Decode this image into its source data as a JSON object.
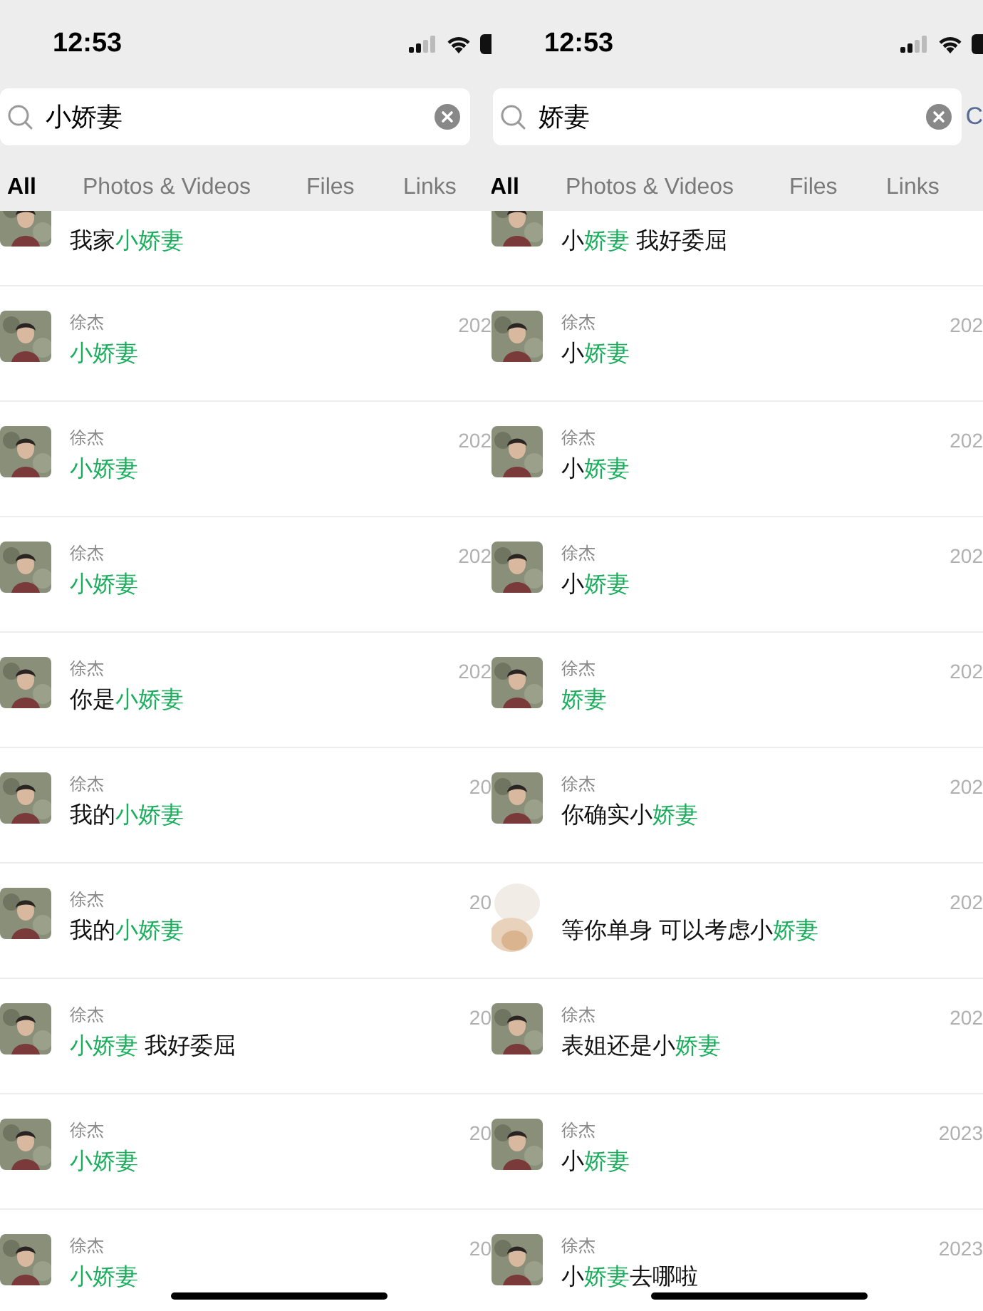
{
  "screens": [
    {
      "status_bar": {
        "time": "12:53"
      },
      "search": {
        "value": "小娇妻"
      },
      "tabs": [
        {
          "label": "All",
          "selected": true
        },
        {
          "label": "Photos & Videos",
          "selected": false
        },
        {
          "label": "Files",
          "selected": false
        },
        {
          "label": "Links",
          "selected": false
        }
      ],
      "results": [
        {
          "obscured": false,
          "message": [
            {
              "text": "我家",
              "highlight": false
            },
            {
              "text": "小娇妻",
              "highlight": true
            }
          ]
        },
        {
          "obscured": false,
          "name": "徐杰",
          "date": "202",
          "message": [
            {
              "text": "小娇妻",
              "highlight": true
            }
          ]
        },
        {
          "obscured": false,
          "name": "徐杰",
          "date": "202",
          "message": [
            {
              "text": "小娇妻",
              "highlight": true
            }
          ]
        },
        {
          "obscured": false,
          "name": "徐杰",
          "date": "202",
          "message": [
            {
              "text": "小娇妻",
              "highlight": true
            }
          ]
        },
        {
          "obscured": false,
          "name": "徐杰",
          "date": "202",
          "message": [
            {
              "text": "你是",
              "highlight": false
            },
            {
              "text": "小娇妻",
              "highlight": true
            }
          ]
        },
        {
          "obscured": false,
          "name": "徐杰",
          "date": "20",
          "message": [
            {
              "text": "我的",
              "highlight": false
            },
            {
              "text": "小娇妻",
              "highlight": true
            }
          ]
        },
        {
          "obscured": false,
          "name": "徐杰",
          "date": "20",
          "message": [
            {
              "text": "我的",
              "highlight": false
            },
            {
              "text": "小娇妻",
              "highlight": true
            }
          ]
        },
        {
          "obscured": false,
          "name": "徐杰",
          "date": "20",
          "message": [
            {
              "text": "小娇妻",
              "highlight": true
            },
            {
              "text": " 我好委屈",
              "highlight": false
            }
          ]
        },
        {
          "obscured": false,
          "name": "徐杰",
          "date": "20",
          "message": [
            {
              "text": "小娇妻",
              "highlight": true
            }
          ]
        },
        {
          "obscured": false,
          "name": "徐杰",
          "date": "20",
          "message": [
            {
              "text": "小娇妻",
              "highlight": true
            }
          ]
        }
      ]
    },
    {
      "status_bar": {
        "time": "12:53"
      },
      "search": {
        "value": "娇妻"
      },
      "cancel": "C",
      "tabs": [
        {
          "label": "All",
          "selected": true
        },
        {
          "label": "Photos & Videos",
          "selected": false
        },
        {
          "label": "Files",
          "selected": false
        },
        {
          "label": "Links",
          "selected": false
        }
      ],
      "results": [
        {
          "obscured": false,
          "message": [
            {
              "text": "小",
              "highlight": false
            },
            {
              "text": "娇妻",
              "highlight": true
            },
            {
              "text": " 我好委屈",
              "highlight": false
            }
          ]
        },
        {
          "obscured": false,
          "name": "徐杰",
          "date": "202",
          "message": [
            {
              "text": "小",
              "highlight": false
            },
            {
              "text": "娇妻",
              "highlight": true
            }
          ]
        },
        {
          "obscured": false,
          "name": "徐杰",
          "date": "202",
          "message": [
            {
              "text": "小",
              "highlight": false
            },
            {
              "text": "娇妻",
              "highlight": true
            }
          ]
        },
        {
          "obscured": false,
          "name": "徐杰",
          "date": "202",
          "message": [
            {
              "text": "小",
              "highlight": false
            },
            {
              "text": "娇妻",
              "highlight": true
            }
          ]
        },
        {
          "obscured": false,
          "name": "徐杰",
          "date": "202",
          "message": [
            {
              "text": "娇妻",
              "highlight": true
            }
          ]
        },
        {
          "obscured": false,
          "name": "徐杰",
          "date": "202",
          "message": [
            {
              "text": "你确实小",
              "highlight": false
            },
            {
              "text": "娇妻",
              "highlight": true
            }
          ]
        },
        {
          "obscured": true,
          "date": "202",
          "message": [
            {
              "text": "等你单身 可以考虑小",
              "highlight": false
            },
            {
              "text": "娇妻",
              "highlight": true
            }
          ]
        },
        {
          "obscured": false,
          "name": "徐杰",
          "date": "202",
          "message": [
            {
              "text": "表姐还是小",
              "highlight": false
            },
            {
              "text": "娇妻",
              "highlight": true
            }
          ]
        },
        {
          "obscured": false,
          "name": "徐杰",
          "date": "2023",
          "message": [
            {
              "text": "小",
              "highlight": false
            },
            {
              "text": "娇妻",
              "highlight": true
            }
          ]
        },
        {
          "obscured": false,
          "name": "徐杰",
          "date": "2023",
          "message": [
            {
              "text": "小",
              "highlight": false
            },
            {
              "text": "娇妻",
              "highlight": true
            },
            {
              "text": "去哪啦",
              "highlight": false
            }
          ]
        }
      ]
    }
  ]
}
